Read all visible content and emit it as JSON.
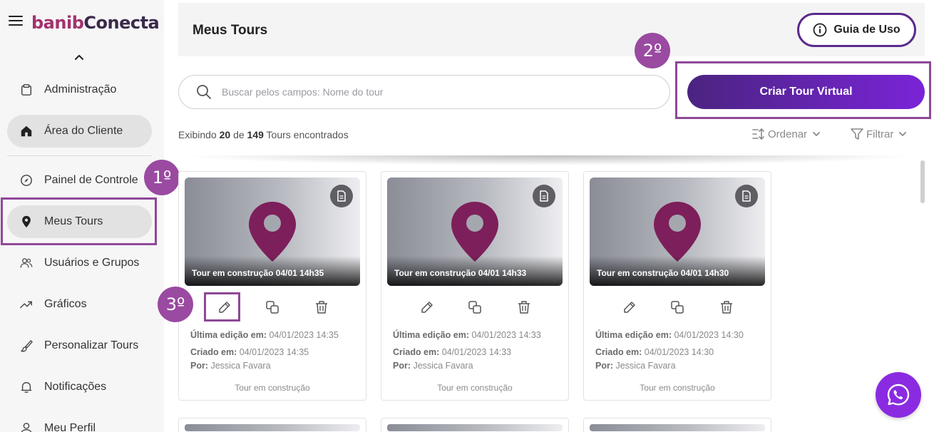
{
  "brand": {
    "logo_part1": "banib",
    "logo_part2": "Conecta"
  },
  "sidebar": {
    "items": [
      {
        "label": "Administração",
        "icon": "clipboard-icon"
      },
      {
        "label": "Área do Cliente",
        "icon": "home-icon",
        "active": true
      },
      {
        "label": "Painel de Controle",
        "icon": "compass-icon"
      },
      {
        "label": "Meus Tours",
        "icon": "location-pin-icon",
        "active": true
      },
      {
        "label": "Usuários e Grupos",
        "icon": "users-icon"
      },
      {
        "label": "Gráficos",
        "icon": "trending-up-icon"
      },
      {
        "label": "Personalizar Tours",
        "icon": "brush-icon"
      },
      {
        "label": "Notificações",
        "icon": "bell-icon"
      },
      {
        "label": "Meu Perfil",
        "icon": "user-icon"
      }
    ]
  },
  "steps": {
    "s1": "1º",
    "s2": "2º",
    "s3": "3º"
  },
  "header": {
    "title": "Meus Tours",
    "guide_label": "Guia de Uso"
  },
  "search": {
    "placeholder": "Buscar pelos campos: Nome do tour",
    "value": ""
  },
  "create_label": "Criar Tour Virtual",
  "results": {
    "prefix": "Exibindo",
    "shown": "20",
    "mid": "de",
    "total": "149",
    "suffix": "Tours encontrados"
  },
  "toolbar": {
    "sort_label": "Ordenar",
    "filter_label": "Filtrar"
  },
  "meta_labels": {
    "edited": "Última edição em:",
    "created": "Criado em:",
    "by": "Por:"
  },
  "tours": [
    {
      "title": "Tour em construção 04/01 14h35",
      "edited": "04/01/2023 14:35",
      "created": "04/01/2023 14:35",
      "author": "Jessica Favara",
      "status": "Tour em construção"
    },
    {
      "title": "Tour em construção 04/01 14h33",
      "edited": "04/01/2023 14:33",
      "created": "04/01/2023 14:33",
      "author": "Jessica Favara",
      "status": "Tour em construção"
    },
    {
      "title": "Tour em construção 04/01 14h30",
      "edited": "04/01/2023 14:30",
      "created": "04/01/2023 14:30",
      "author": "Jessica Favara",
      "status": "Tour em construção"
    }
  ],
  "colors": {
    "accent": "#8e4897",
    "brand_pin": "#7d1f5a",
    "button_start": "#4a2480",
    "button_end": "#7a24d8",
    "whatsapp": "#8a2be2"
  }
}
